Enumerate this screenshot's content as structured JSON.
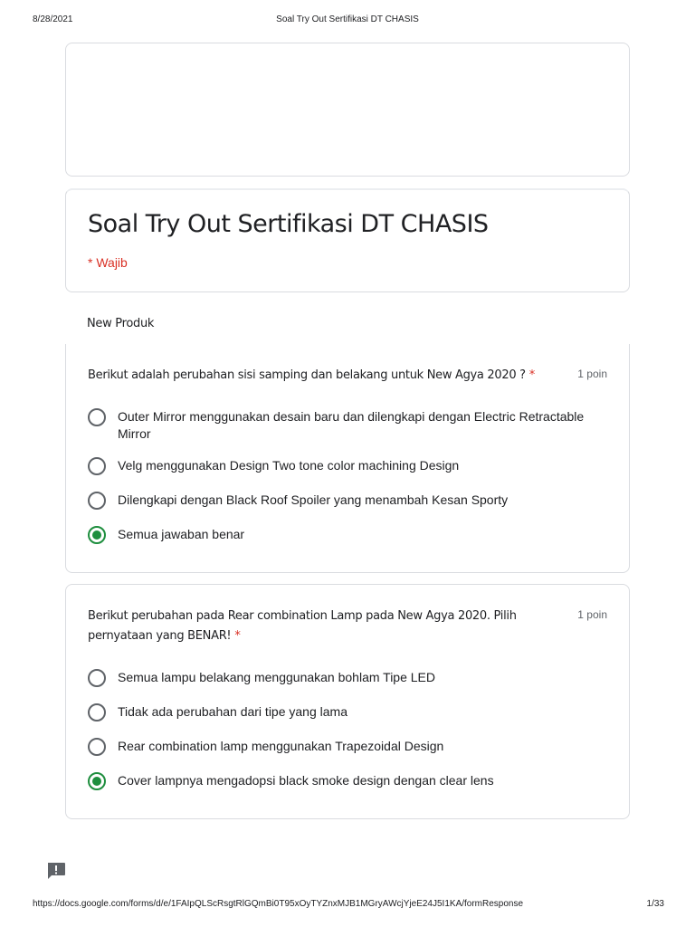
{
  "print_header": {
    "date": "8/28/2021",
    "title": "Soal Try Out Sertifikasi DT CHASIS"
  },
  "form": {
    "title": "Soal Try Out Sertifikasi DT CHASIS",
    "required_note": "* Wajib"
  },
  "section": {
    "title": "New Produk"
  },
  "questions": [
    {
      "text": "Berikut adalah perubahan sisi samping dan belakang untuk New Agya 2020 ?",
      "required_mark": "*",
      "points": "1 poin",
      "options": [
        "Outer Mirror menggunakan desain baru dan dilengkapi dengan Electric Retractable Mirror",
        "Velg menggunakan Design Two tone color machining Design",
        "Dilengkapi dengan Black Roof Spoiler yang menambah Kesan Sporty",
        "Semua jawaban benar"
      ],
      "selected_index": 3
    },
    {
      "text": "Berikut perubahan pada Rear combination Lamp pada New Agya 2020. Pilih pernyataan yang BENAR!",
      "required_mark": "*",
      "points": "1 poin",
      "options": [
        "Semua lampu belakang menggunakan bohlam Tipe LED",
        "Tidak ada perubahan dari tipe yang lama",
        "Rear combination lamp menggunakan Trapezoidal Design",
        "Cover lampnya mengadopsi black smoke design dengan clear lens"
      ],
      "selected_index": 3
    }
  ],
  "colors": {
    "required": "#d93025",
    "selected": "#1e8e3e",
    "border": "#dadce0"
  },
  "icons": {
    "feedback": "report-feedback-icon"
  },
  "print_footer": {
    "url": "https://docs.google.com/forms/d/e/1FAIpQLScRsgtRlGQmBi0T95xOyTYZnxMJB1MGryAWcjYjeE24J5I1KA/formResponse",
    "page": "1/33"
  }
}
